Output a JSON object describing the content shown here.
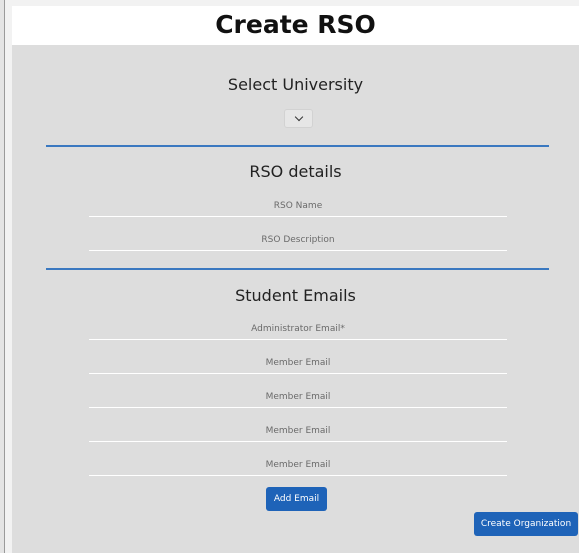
{
  "header": {
    "title": "Create RSO"
  },
  "university_section": {
    "title": "Select University",
    "selected_value": ""
  },
  "rso_details": {
    "title": "RSO details",
    "name_placeholder": "RSO Name",
    "description_placeholder": "RSO Description"
  },
  "student_emails": {
    "title": "Student Emails",
    "admin_placeholder": "Administrator Email*",
    "member_placeholders": [
      "Member Email",
      "Member Email",
      "Member Email",
      "Member Email"
    ]
  },
  "buttons": {
    "add_email": "Add Email",
    "create_organization": "Create Organization"
  },
  "colors": {
    "accent": "#1e63b8",
    "divider": "#3a78c0",
    "panel": "#dddddd"
  }
}
